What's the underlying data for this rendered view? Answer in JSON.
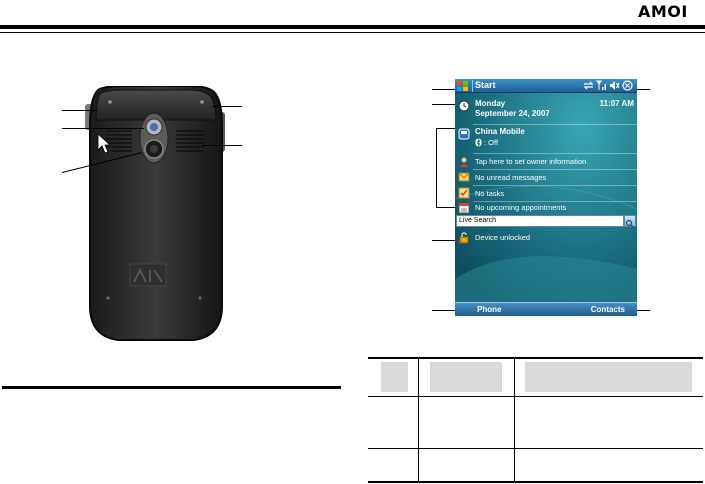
{
  "header": {
    "brand": "AMOI"
  },
  "pda": {
    "title_bar": {
      "start_label": "Start",
      "icons": [
        "sync-icon",
        "signal-icon",
        "volume-icon",
        "close-icon"
      ]
    },
    "date": {
      "day": "Monday",
      "date": "September 24, 2007",
      "time": "11:07 AM"
    },
    "operator": {
      "name": "China Mobile",
      "bluetooth_status": ": Off"
    },
    "items": [
      {
        "icon": "owner-icon",
        "text": "Tap here to set owner information"
      },
      {
        "icon": "messages-icon",
        "text": "No unread messages"
      },
      {
        "icon": "tasks-icon",
        "text": "No tasks"
      },
      {
        "icon": "calendar-icon",
        "text": "No upcoming appointments"
      }
    ],
    "search": {
      "placeholder": "Live Search"
    },
    "lock_status": "Device unlocked",
    "softkeys": {
      "left": "Phone",
      "right": "Contacts"
    }
  },
  "colors": {
    "screen_teal": "#1c6f80",
    "title_blue": "#2a73ad",
    "table_gray": "#d9d9d9"
  }
}
